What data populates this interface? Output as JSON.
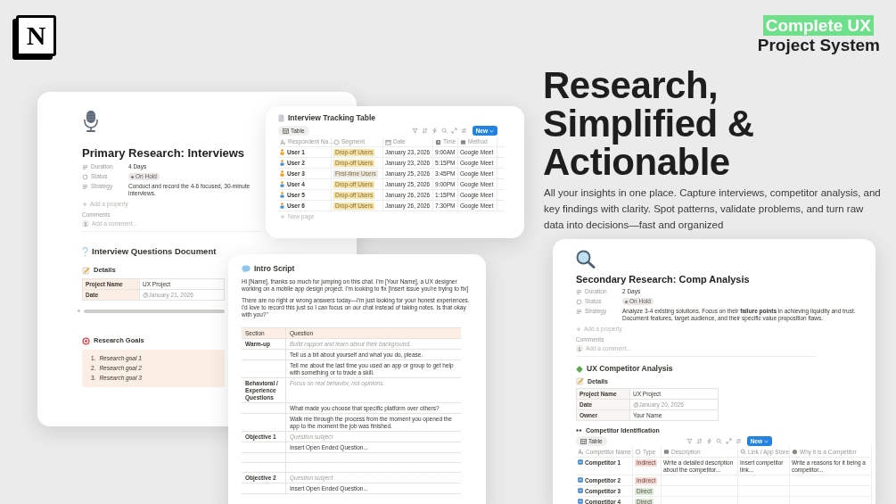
{
  "logo": {
    "letter": "N"
  },
  "brand": {
    "highlight": "Complete UX",
    "subtitle": "Project System"
  },
  "headline": [
    "Research,",
    "Simplified &",
    "Actionable"
  ],
  "tagline": "All your insights in one place. Capture interviews, competitor analysis, and key findings with clarity. Spot patterns, validate problems, and turn raw data into decisions—fast and organized",
  "primary_page": {
    "title": "Primary Research: Interviews",
    "properties": [
      {
        "label": "Duration",
        "value": "4 Days",
        "kind": "text"
      },
      {
        "label": "Status",
        "value": "On Hold",
        "kind": "status"
      },
      {
        "label": "Strategy",
        "value": "Conduct and record the 4-6 focused, 30-minute interviews.",
        "kind": "text"
      }
    ],
    "add_property": "Add a property",
    "comments_label": "Comments",
    "comment_placeholder": "Add a comment...",
    "section_title": "Interview Questions Document",
    "details_heading": "Details",
    "details": [
      {
        "label": "Project Name",
        "value": "UX Project",
        "kind": "text"
      },
      {
        "label": "Date",
        "value": "@January 21, 2026",
        "kind": "mention"
      }
    ],
    "goals_heading": "Research Goals",
    "goals": [
      {
        "number": "1.",
        "text": "Research goal 1"
      },
      {
        "number": "2.",
        "text": "Research goal 2"
      },
      {
        "number": "3.",
        "text": "Research goal 3"
      }
    ]
  },
  "tracking_table": {
    "title": "Interview Tracking Table",
    "view": "Table",
    "new_button": "New",
    "columns": [
      {
        "label": "Respondent Na…",
        "kind": "title"
      },
      {
        "label": "Segment",
        "kind": "select"
      },
      {
        "label": "Date",
        "kind": "date"
      },
      {
        "label": "Time",
        "kind": "time"
      },
      {
        "label": "Method",
        "kind": "text"
      }
    ],
    "rows": [
      {
        "name": "User 1",
        "segment": "Drop-off Users",
        "color": "#f5e3a8",
        "date": "January 23, 2026",
        "time": "9:00AM",
        "method": "Google Meet"
      },
      {
        "name": "User 2",
        "segment": "Drop-off Users",
        "color": "#f5e3a8",
        "date": "January 23, 2026",
        "time": "5:15PM",
        "method": "Google Meet"
      },
      {
        "name": "User 3",
        "segment": "First-time Users",
        "color": "#e9e8e5",
        "date": "January 25, 2026",
        "time": "3:45PM",
        "method": "Google Meet"
      },
      {
        "name": "User 4",
        "segment": "Drop-off Users",
        "color": "#f5e3a8",
        "date": "January 25, 2026",
        "time": "9:00PM",
        "method": "Google Meet"
      },
      {
        "name": "User 5",
        "segment": "Drop-off Users",
        "color": "#f5e3a8",
        "date": "January 26, 2026",
        "time": "1:15PM",
        "method": "Google Meet"
      },
      {
        "name": "User 6",
        "segment": "Drop-off Users",
        "color": "#f5e3a8",
        "date": "January 26, 2026",
        "time": "7:30PM",
        "method": "Google Meet"
      }
    ],
    "new_page": "New page"
  },
  "intro_script": {
    "title": "Intro Script",
    "paragraphs": [
      "Hi [Name], thanks so much for jumping on this chat. I'm [Your Name], a UX designer working on a mobile app design project. I'm looking to fix [Insert issue you're trying to fix]",
      "There are no right or wrong answers today—I'm just looking for your honest experiences. I'd love to record this just so I can focus on our chat instead of taking notes. Is that okay with you?\""
    ],
    "columns": [
      "Section",
      "Question"
    ],
    "rows": [
      {
        "section": "Warm-up",
        "question": "Build rapport and learn about their background.",
        "kind": "hint"
      },
      {
        "question": "Tell us a bit about yourself and what you do, please.",
        "kind": "question"
      },
      {
        "question": "Tell me about the last time you used an app or group to get help with something or to trade a skill.",
        "kind": "question"
      },
      {
        "section": "Behavioral / Experience Questions",
        "question": "Focus on real behavior, not opinions.",
        "kind": "hint"
      },
      {
        "question": "What made you choose that specific platform over others?",
        "kind": "question"
      },
      {
        "question": "Walk me through the process from the moment you opened the app to the moment the job was finished.",
        "kind": "question"
      },
      {
        "section": "Objective 1",
        "question": "Question subject",
        "kind": "hint"
      },
      {
        "question": "Insert Open Ended Question...",
        "kind": "question"
      },
      {
        "kind": "blank"
      },
      {
        "kind": "blank"
      },
      {
        "section": "Objective 2",
        "question": "Question subject",
        "kind": "hint"
      },
      {
        "question": "Insert Open Ended Question...",
        "kind": "question"
      }
    ]
  },
  "secondary_page": {
    "title": "Secondary Research: Comp Analysis",
    "properties": [
      {
        "label": "Duration",
        "value": "2 Days",
        "kind": "text"
      },
      {
        "label": "Status",
        "value": "On Hold",
        "kind": "status"
      },
      {
        "label": "Strategy",
        "value": "Analyze 3-4 existing solutions. Focus on their **failure points** in achieving liquidity and trust. Document features, target audience, and their specific value proposition flaws.",
        "kind": "text"
      }
    ],
    "add_property": "Add a property",
    "comments_label": "Comments",
    "comment_placeholder": "Add a comment...",
    "section_title": "UX Competitor Analysis",
    "details_heading": "Details",
    "details": [
      {
        "label": "Project Name",
        "value": "UX Project",
        "kind": "text"
      },
      {
        "label": "Date",
        "value": "@January 20, 2026",
        "kind": "mention"
      },
      {
        "label": "Owner",
        "value": "Your Name",
        "kind": "text"
      }
    ],
    "table_heading": "Competitor Identification",
    "view": "Table",
    "new_button": "New",
    "columns": [
      {
        "label": "Competitor Name",
        "kind": "title"
      },
      {
        "label": "Type",
        "kind": "select"
      },
      {
        "label": "Description",
        "kind": "text"
      },
      {
        "label": "Link / App Store",
        "kind": "link"
      },
      {
        "label": "Why it is a Competitor",
        "kind": "info"
      }
    ],
    "rows": [
      {
        "name": "Competitor 1",
        "type": "Indirect",
        "color": "#f9d9d4",
        "description": "Write a detailed description about the competitor...",
        "link": "Insert competitor link...",
        "reason": "Write a reasons for it being a competitor..."
      },
      {
        "name": "Competitor 2",
        "type": "Indirect",
        "color": "#f9d9d4"
      },
      {
        "name": "Competitor 3",
        "type": "Direct",
        "color": "#d6ecd9"
      },
      {
        "name": "Competitor 4",
        "type": "Direct",
        "color": "#d6ecd9"
      }
    ]
  }
}
